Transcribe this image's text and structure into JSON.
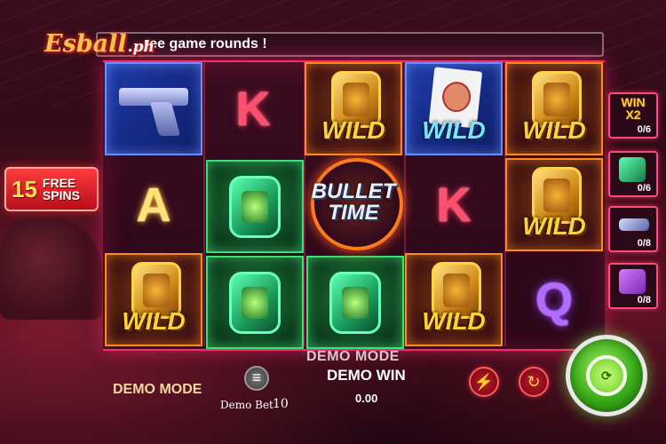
{
  "logo": {
    "main": "Esball",
    "sub": ".ph"
  },
  "ticker": {
    "text": "ree game rounds !"
  },
  "free_spins": {
    "count": "15",
    "line1": "FREE",
    "line2": "SPINS"
  },
  "reels": [
    [
      {
        "type": "gun"
      },
      {
        "type": "letter",
        "text": "A"
      },
      {
        "type": "wild-gold",
        "text": "WILD"
      }
    ],
    [
      {
        "type": "letter",
        "text": "K"
      },
      {
        "type": "watch-green"
      },
      {
        "type": "watch-green"
      }
    ],
    [
      {
        "type": "wild-gold",
        "text": "WILD"
      },
      {
        "type": "bullet-time"
      },
      {
        "type": "watch-green"
      }
    ],
    [
      {
        "type": "wild-id",
        "text": "WILD"
      },
      {
        "type": "letter",
        "text": "K"
      },
      {
        "type": "wild-gold",
        "text": "WILD"
      }
    ],
    [
      {
        "type": "wild-gold",
        "text": "WILD"
      },
      {
        "type": "wild-gold",
        "text": "WILD"
      },
      {
        "type": "letter",
        "text": "Q"
      }
    ]
  ],
  "bullet_time": {
    "line1": "BULLET",
    "line2": "TIME"
  },
  "side_panel": {
    "win_label": "WIN",
    "multiplier": "X2",
    "win_count": "0/6",
    "watch_count": "0/6",
    "gun_count": "0/8",
    "case_count": "0/8"
  },
  "footer": {
    "demo_mode_left": "DEMO MODE",
    "demo_bet_label": "Demo Bet",
    "demo_bet_value": "10",
    "demo_mode_center": "DEMO MODE",
    "demo_win_label": "DEMO WIN",
    "demo_win_value": "0.00"
  },
  "icons": {
    "chip": "chip-stack-icon",
    "turbo": "lightning-icon",
    "autoplay": "refresh-icon",
    "spin": "spin-icon"
  },
  "colors": {
    "board_border": "#ff2a6a",
    "spin_green": "#3aa81a",
    "wild_gold": "#ffd23a"
  }
}
